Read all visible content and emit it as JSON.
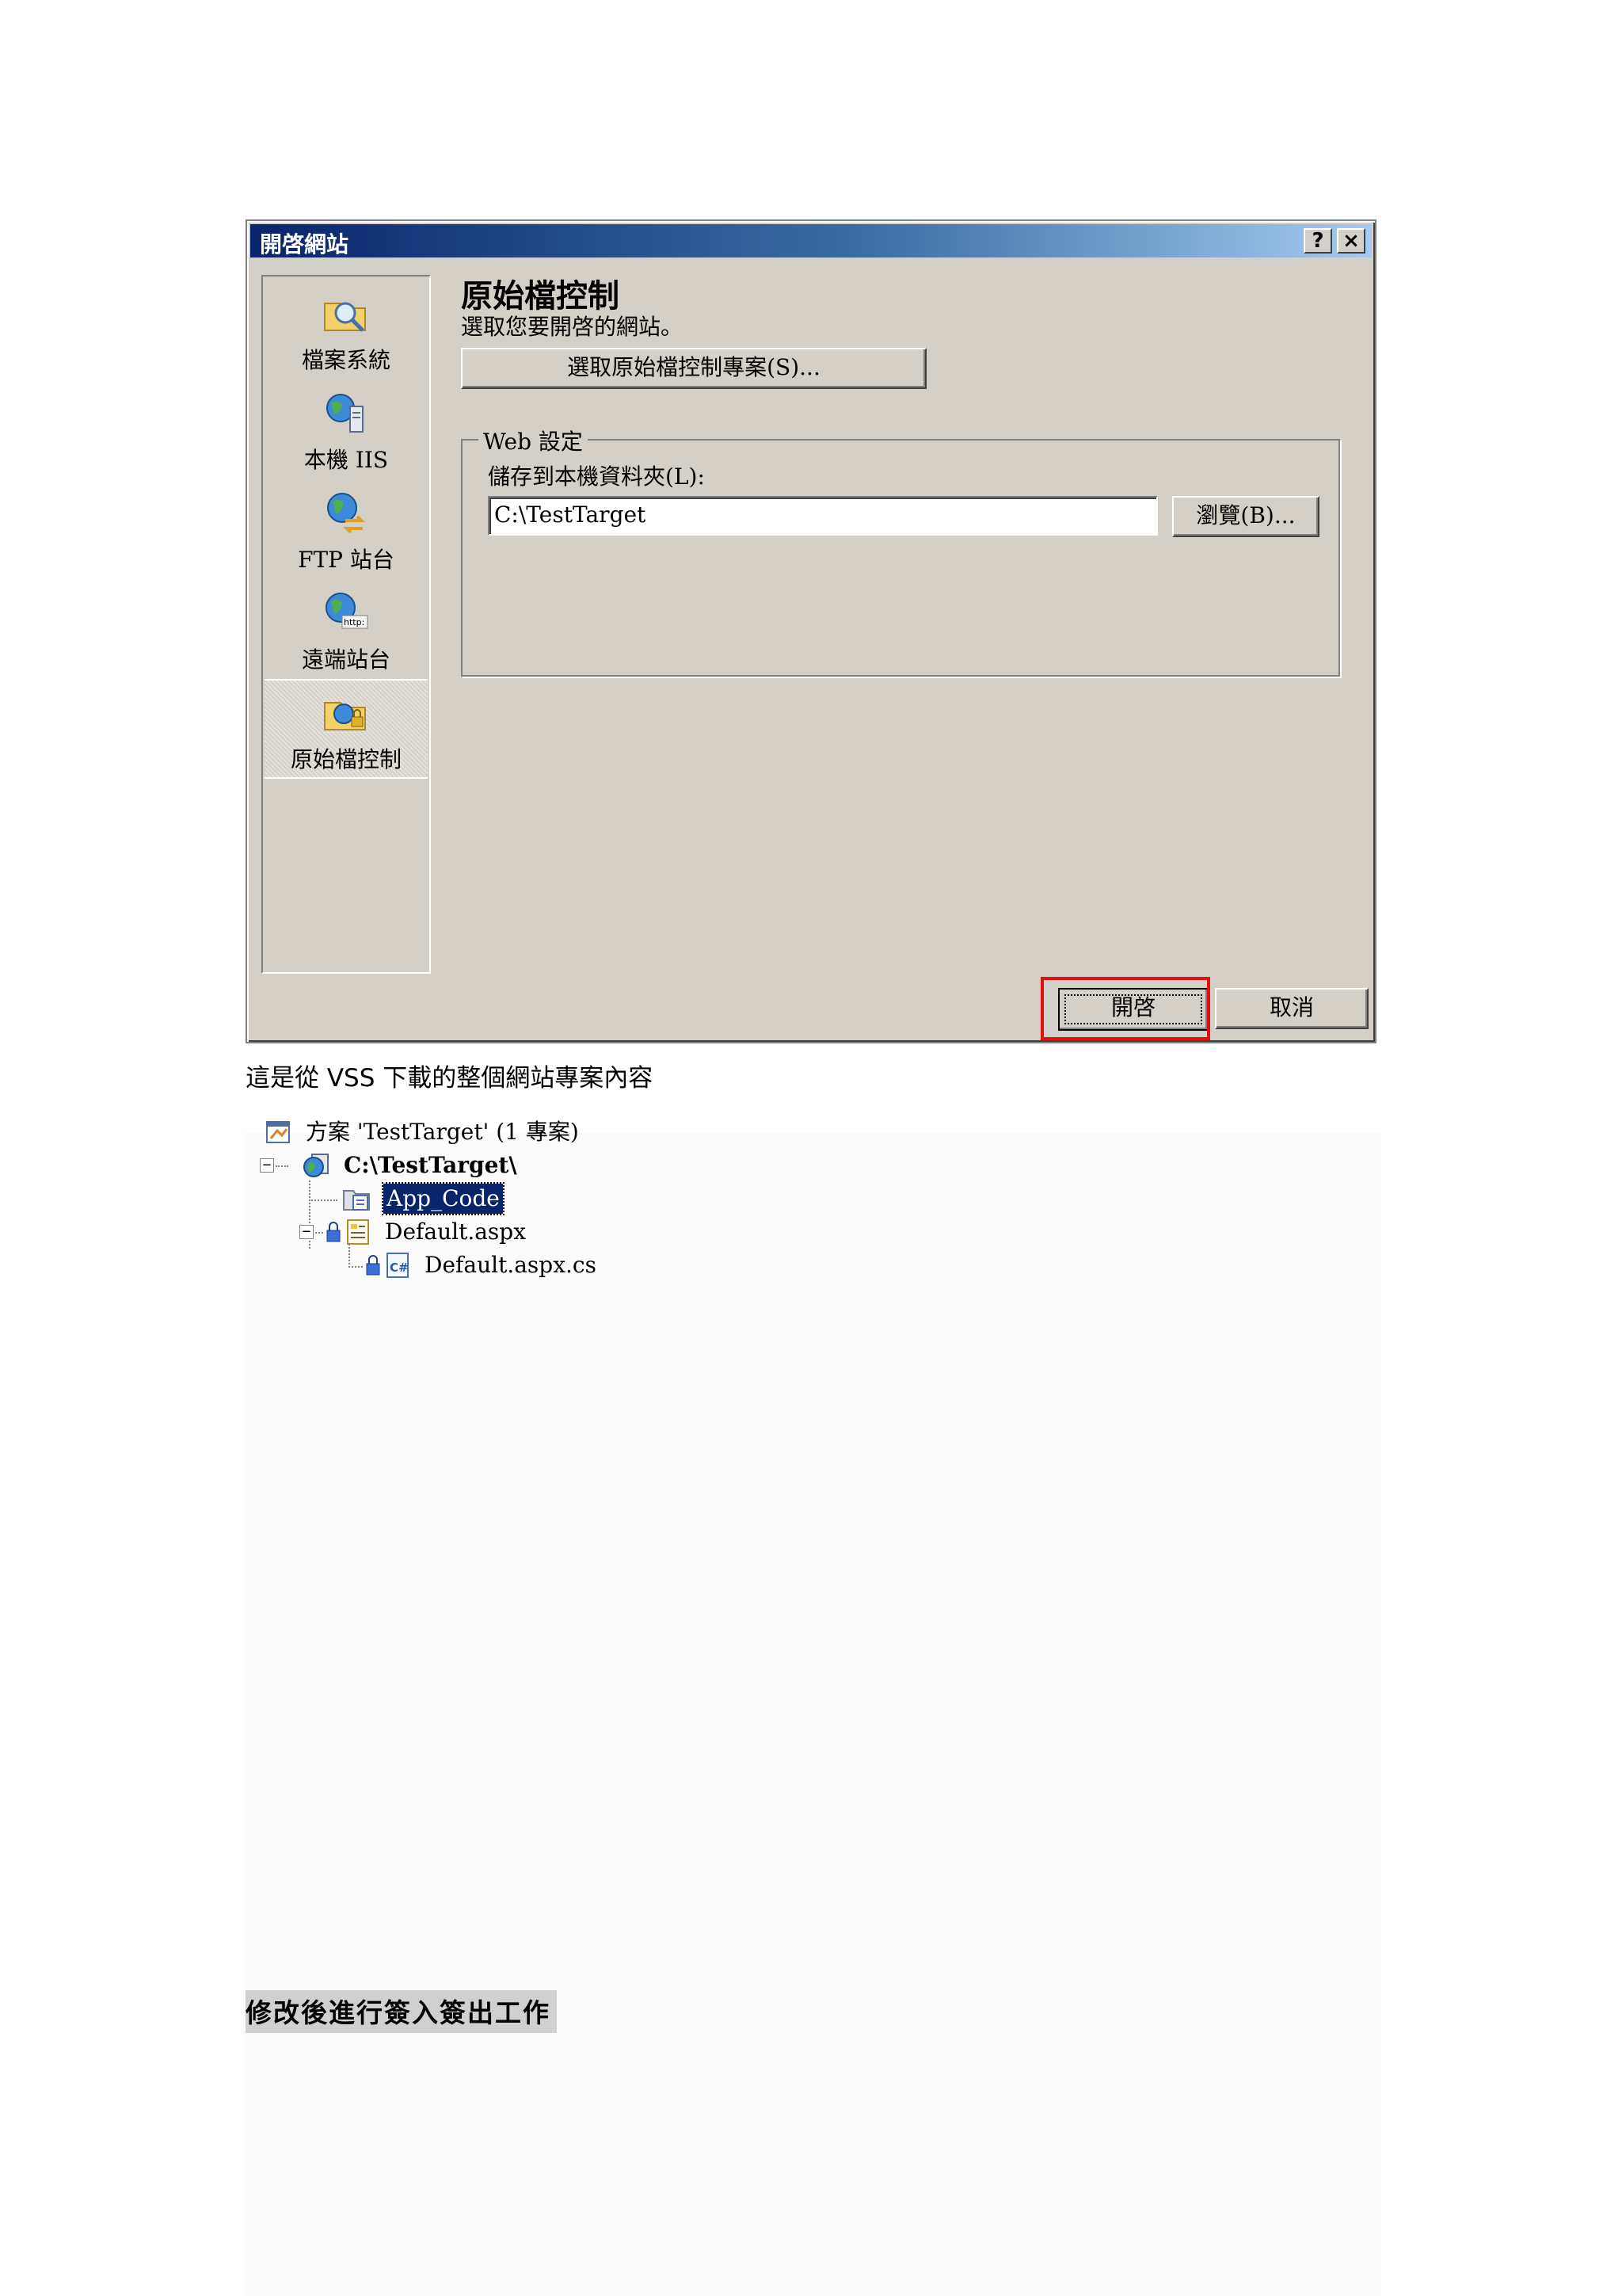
{
  "dialog": {
    "title": "開啓網站",
    "help_button": "?",
    "close_button": "×",
    "sidebar": [
      {
        "label": "檔案系統",
        "icon": "folder-search-icon"
      },
      {
        "label": "本機 IIS",
        "icon": "local-iis-icon"
      },
      {
        "label": "FTP 站台",
        "icon": "ftp-site-icon"
      },
      {
        "label": "遠端站台",
        "icon": "remote-site-icon"
      },
      {
        "label": "原始檔控制",
        "icon": "source-control-icon",
        "selected": true
      }
    ],
    "heading": "原始檔控制",
    "subtext": "選取您要開啓的網站。",
    "select_project_button": "選取原始檔控制專案(S)...",
    "web_settings": {
      "group_title": "Web 設定",
      "save_label": "儲存到本機資料夾(L):",
      "save_path": "C:\\TestTarget",
      "browse_button": "瀏覽(B)..."
    },
    "open_button": "開啓",
    "cancel_button": "取消"
  },
  "caption": "這是從 VSS 下載的整個網站專案內容",
  "tree": {
    "solution": "方案 'TestTarget' (1 專案)",
    "project": "C:\\TestTarget\\",
    "items": [
      "App_Code",
      "Default.aspx",
      "Default.aspx.cs"
    ]
  },
  "section_heading": "修改後進行簽入簽出工作",
  "colors": {
    "title_start": "#0a246a",
    "title_end": "#a6caf0",
    "highlight": "#e01010",
    "selection": "#0a246a"
  }
}
